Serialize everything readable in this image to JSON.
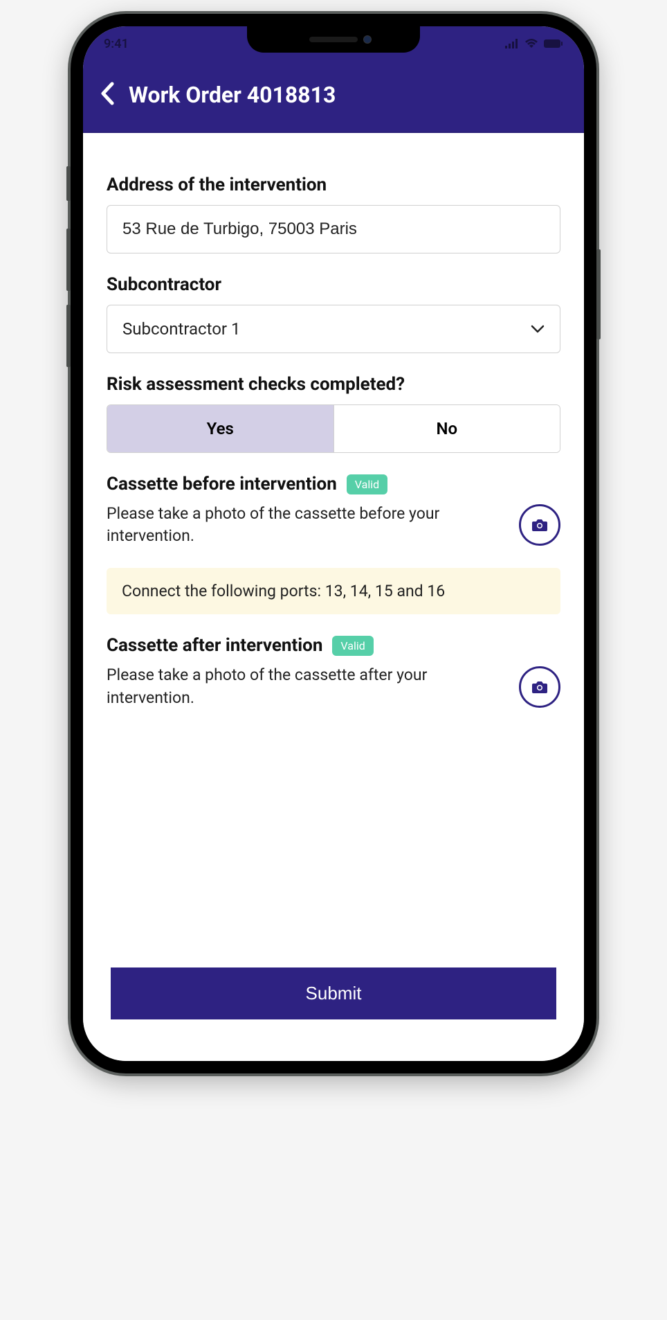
{
  "status": {
    "time": "9:41"
  },
  "header": {
    "title": "Work Order 4018813"
  },
  "form": {
    "address": {
      "label": "Address of the intervention",
      "value": "53 Rue de Turbigo, 75003 Paris"
    },
    "subcontractor": {
      "label": "Subcontractor",
      "value": "Subcontractor 1"
    },
    "risk": {
      "label": "Risk assessment checks completed?",
      "options": {
        "yes": "Yes",
        "no": "No"
      },
      "selected": "yes"
    },
    "cassette_before": {
      "title": "Cassette before intervention",
      "badge": "Valid",
      "desc": "Please take a photo of the cassette before your intervention."
    },
    "info_banner": "Connect the following ports: 13, 14, 15 and 16",
    "cassette_after": {
      "title": "Cassette after intervention",
      "badge": "Valid",
      "desc": "Please take a photo of the cassette after your intervention."
    }
  },
  "submit_label": "Submit"
}
